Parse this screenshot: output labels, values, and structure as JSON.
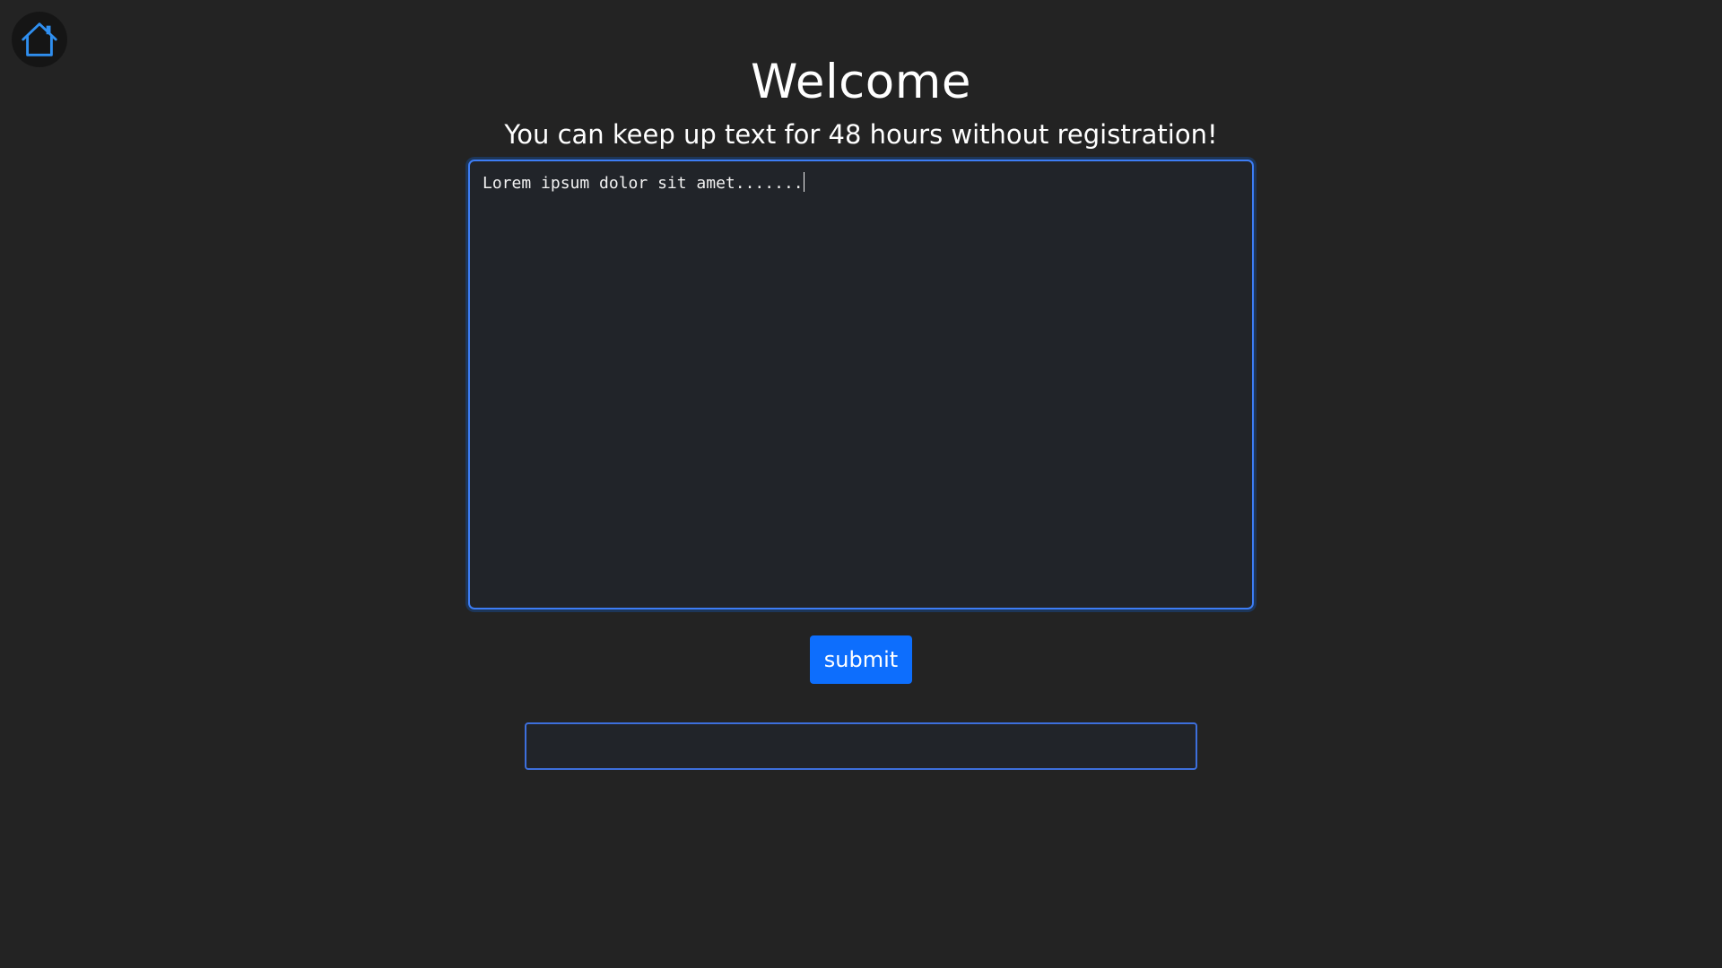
{
  "header": {
    "home_icon": "home-icon",
    "title": "Welcome",
    "subtitle": "You can keep up text for 48 hours without registration!"
  },
  "editor": {
    "value": "Lorem ipsum dolor sit amet......."
  },
  "actions": {
    "submit_label": "submit"
  },
  "result": {
    "value": ""
  },
  "colors": {
    "background": "#232323",
    "accent": "#0d6efd",
    "field_background": "#212429"
  }
}
